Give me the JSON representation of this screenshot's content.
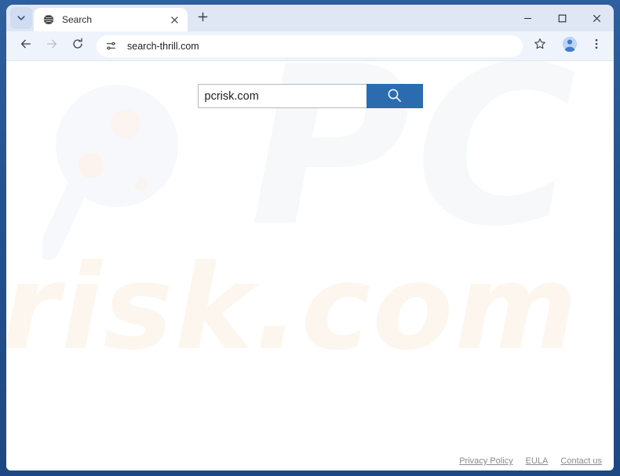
{
  "window": {
    "frame_color": "#24538f",
    "controls": {
      "minimize_label": "–",
      "maximize_label": "□",
      "close_label": "✕"
    }
  },
  "tabstrip": {
    "tab_search_icon": "chevron-down-icon",
    "new_tab_label": "+",
    "tabs": [
      {
        "title": "Search",
        "favicon": "globe-icon",
        "close_label": "✕",
        "active": true
      }
    ]
  },
  "toolbar": {
    "back_icon": "arrow-left-icon",
    "forward_icon": "arrow-right-icon",
    "reload_icon": "reload-icon",
    "site_settings_icon": "tune-icon",
    "url": "search-thrill.com",
    "url_placeholder": "Search Google or type a URL",
    "bookmark_icon": "star-icon",
    "profile_icon": "account-avatar-icon",
    "menu_icon": "three-dot-menu-icon",
    "profile_color": "#4a86d8"
  },
  "page": {
    "search": {
      "value": "pcrisk.com",
      "placeholder": "",
      "button_icon": "search-icon",
      "button_color": "#2b6cb0"
    },
    "watermark": {
      "logo_text": "PC",
      "domain_text": "risk.com",
      "glass_icon": "magnifier-icon",
      "logo_color": "#f7f8fa",
      "domain_color": "#fdf6ee"
    },
    "footer": {
      "links": [
        {
          "label": "Privacy Policy"
        },
        {
          "label": "EULA"
        },
        {
          "label": "Contact us"
        }
      ]
    }
  }
}
